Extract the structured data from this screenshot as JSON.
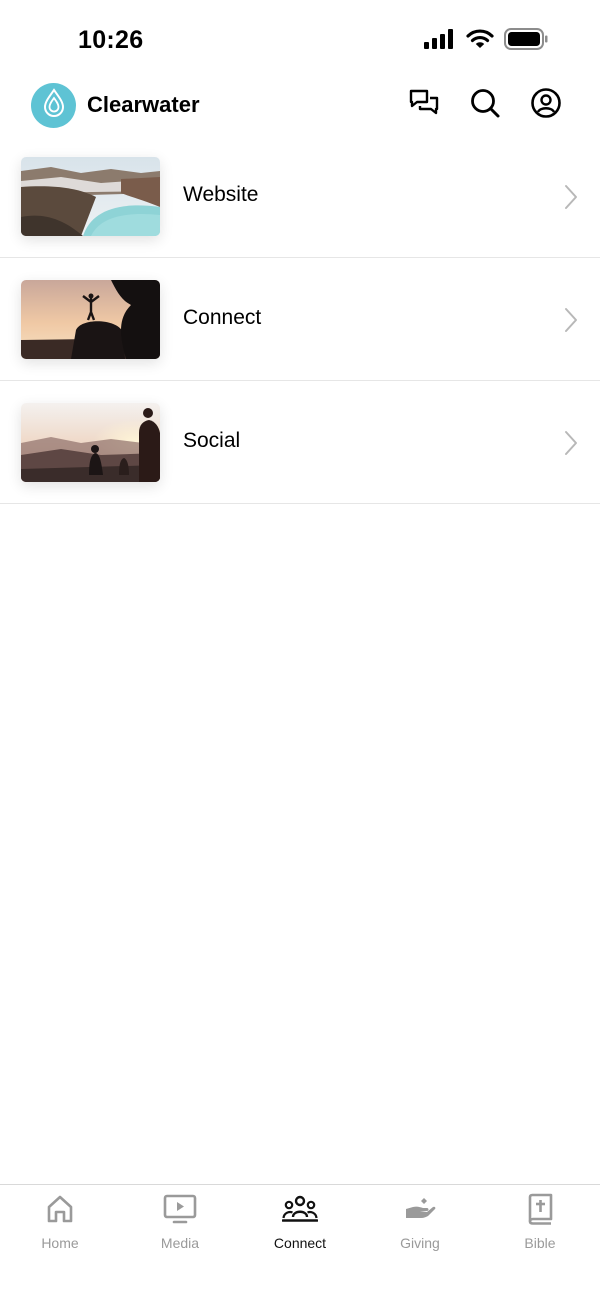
{
  "status_bar": {
    "time": "10:26",
    "icons": [
      "signal-icon",
      "wifi-icon",
      "battery-icon"
    ]
  },
  "header": {
    "title": "Clearwater",
    "logo_icon": "water-drop-icon",
    "logo_color": "#5ec3d4",
    "actions": [
      "chat-icon",
      "search-icon",
      "profile-icon"
    ]
  },
  "list": {
    "items": [
      {
        "label": "Website",
        "thumbnail": "crater-lake-photo"
      },
      {
        "label": "Connect",
        "thumbnail": "sunset-silhouette-photo"
      },
      {
        "label": "Social",
        "thumbnail": "mountain-sunset-group-photo"
      }
    ]
  },
  "tab_bar": {
    "active_color": "#111111",
    "inactive_color": "#9a9a9a",
    "tabs": [
      {
        "label": "Home",
        "icon": "home-icon",
        "active": false
      },
      {
        "label": "Media",
        "icon": "media-play-icon",
        "active": false
      },
      {
        "label": "Connect",
        "icon": "people-icon",
        "active": true
      },
      {
        "label": "Giving",
        "icon": "giving-hand-icon",
        "active": false
      },
      {
        "label": "Bible",
        "icon": "bible-icon",
        "active": false
      }
    ]
  }
}
